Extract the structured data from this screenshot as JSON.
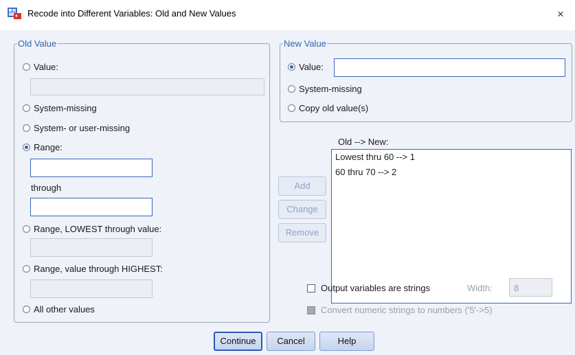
{
  "window": {
    "title": "Recode into Different Variables: Old and New Values",
    "close_glyph": "×"
  },
  "old_value": {
    "legend": "Old Value",
    "value_label": "Value:",
    "system_missing_label": "System-missing",
    "system_user_missing_label": "System- or user-missing",
    "range_label": "Range:",
    "through_label": "through",
    "range_lowest_label": "Range, LOWEST through value:",
    "range_highest_label": "Range, value through HIGHEST:",
    "all_other_label": "All other values",
    "selected": "Range"
  },
  "new_value": {
    "legend": "New Value",
    "value_label": "Value:",
    "system_missing_label": "System-missing",
    "copy_old_label": "Copy old value(s)",
    "selected": "Value"
  },
  "mapping": {
    "header": "Old --> New:",
    "items": [
      "Lowest thru 60 --> 1",
      "60 thru 70 --> 2"
    ],
    "add_label": "Add",
    "change_label": "Change",
    "remove_label": "Remove"
  },
  "options": {
    "output_strings_label": "Output variables are strings",
    "width_label": "Width:",
    "width_value": "8",
    "convert_label": "Convert numeric strings to numbers ('5'->5)"
  },
  "buttons": {
    "continue_label": "Continue",
    "cancel_label": "Cancel",
    "help_label": "Help"
  },
  "icons": {
    "app_icon": "spss-dialog-icon",
    "close_icon": "close-icon"
  }
}
